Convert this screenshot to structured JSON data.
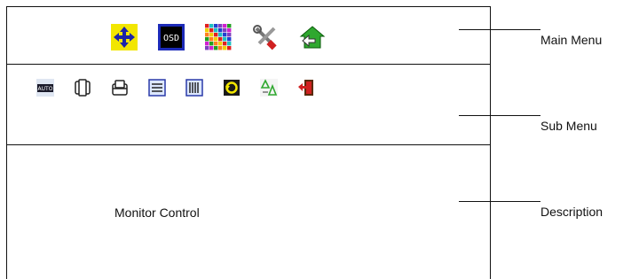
{
  "main_menu": {
    "label": "Main Menu",
    "icons": [
      "position-icon",
      "osd-icon",
      "color-icon",
      "tools-icon",
      "exit-icon"
    ],
    "osd_text": "OSD"
  },
  "sub_menu": {
    "label": "Sub Menu",
    "icons": [
      "auto-adjust-icon",
      "h-position-icon",
      "v-position-icon",
      "phase-icon",
      "clock-icon",
      "reset-icon",
      "language-icon",
      "exit-door-icon"
    ],
    "auto_text": "AUTO"
  },
  "description": {
    "label": "Description",
    "text": "Monitor Control"
  },
  "colors": {
    "line": "#111111",
    "yellow": "#f2e600",
    "blue": "#1c24a8",
    "green": "#2fa82f",
    "red": "#d02020"
  }
}
